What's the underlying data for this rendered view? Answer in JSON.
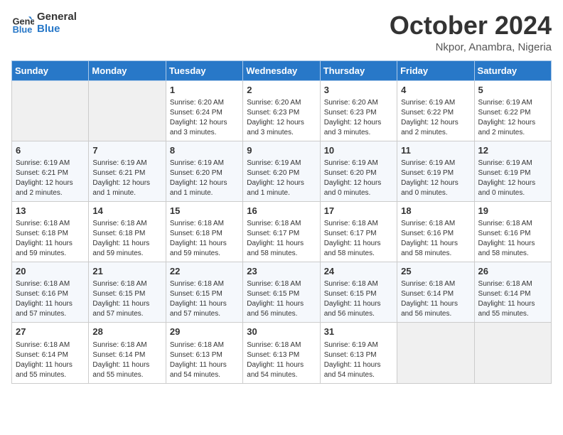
{
  "header": {
    "logo_line1": "General",
    "logo_line2": "Blue",
    "month": "October 2024",
    "location": "Nkpor, Anambra, Nigeria"
  },
  "weekdays": [
    "Sunday",
    "Monday",
    "Tuesday",
    "Wednesday",
    "Thursday",
    "Friday",
    "Saturday"
  ],
  "weeks": [
    [
      {
        "day": "",
        "info": ""
      },
      {
        "day": "",
        "info": ""
      },
      {
        "day": "1",
        "info": "Sunrise: 6:20 AM\nSunset: 6:24 PM\nDaylight: 12 hours and 3 minutes."
      },
      {
        "day": "2",
        "info": "Sunrise: 6:20 AM\nSunset: 6:23 PM\nDaylight: 12 hours and 3 minutes."
      },
      {
        "day": "3",
        "info": "Sunrise: 6:20 AM\nSunset: 6:23 PM\nDaylight: 12 hours and 3 minutes."
      },
      {
        "day": "4",
        "info": "Sunrise: 6:19 AM\nSunset: 6:22 PM\nDaylight: 12 hours and 2 minutes."
      },
      {
        "day": "5",
        "info": "Sunrise: 6:19 AM\nSunset: 6:22 PM\nDaylight: 12 hours and 2 minutes."
      }
    ],
    [
      {
        "day": "6",
        "info": "Sunrise: 6:19 AM\nSunset: 6:21 PM\nDaylight: 12 hours and 2 minutes."
      },
      {
        "day": "7",
        "info": "Sunrise: 6:19 AM\nSunset: 6:21 PM\nDaylight: 12 hours and 1 minute."
      },
      {
        "day": "8",
        "info": "Sunrise: 6:19 AM\nSunset: 6:20 PM\nDaylight: 12 hours and 1 minute."
      },
      {
        "day": "9",
        "info": "Sunrise: 6:19 AM\nSunset: 6:20 PM\nDaylight: 12 hours and 1 minute."
      },
      {
        "day": "10",
        "info": "Sunrise: 6:19 AM\nSunset: 6:20 PM\nDaylight: 12 hours and 0 minutes."
      },
      {
        "day": "11",
        "info": "Sunrise: 6:19 AM\nSunset: 6:19 PM\nDaylight: 12 hours and 0 minutes."
      },
      {
        "day": "12",
        "info": "Sunrise: 6:19 AM\nSunset: 6:19 PM\nDaylight: 12 hours and 0 minutes."
      }
    ],
    [
      {
        "day": "13",
        "info": "Sunrise: 6:18 AM\nSunset: 6:18 PM\nDaylight: 11 hours and 59 minutes."
      },
      {
        "day": "14",
        "info": "Sunrise: 6:18 AM\nSunset: 6:18 PM\nDaylight: 11 hours and 59 minutes."
      },
      {
        "day": "15",
        "info": "Sunrise: 6:18 AM\nSunset: 6:18 PM\nDaylight: 11 hours and 59 minutes."
      },
      {
        "day": "16",
        "info": "Sunrise: 6:18 AM\nSunset: 6:17 PM\nDaylight: 11 hours and 58 minutes."
      },
      {
        "day": "17",
        "info": "Sunrise: 6:18 AM\nSunset: 6:17 PM\nDaylight: 11 hours and 58 minutes."
      },
      {
        "day": "18",
        "info": "Sunrise: 6:18 AM\nSunset: 6:16 PM\nDaylight: 11 hours and 58 minutes."
      },
      {
        "day": "19",
        "info": "Sunrise: 6:18 AM\nSunset: 6:16 PM\nDaylight: 11 hours and 58 minutes."
      }
    ],
    [
      {
        "day": "20",
        "info": "Sunrise: 6:18 AM\nSunset: 6:16 PM\nDaylight: 11 hours and 57 minutes."
      },
      {
        "day": "21",
        "info": "Sunrise: 6:18 AM\nSunset: 6:15 PM\nDaylight: 11 hours and 57 minutes."
      },
      {
        "day": "22",
        "info": "Sunrise: 6:18 AM\nSunset: 6:15 PM\nDaylight: 11 hours and 57 minutes."
      },
      {
        "day": "23",
        "info": "Sunrise: 6:18 AM\nSunset: 6:15 PM\nDaylight: 11 hours and 56 minutes."
      },
      {
        "day": "24",
        "info": "Sunrise: 6:18 AM\nSunset: 6:15 PM\nDaylight: 11 hours and 56 minutes."
      },
      {
        "day": "25",
        "info": "Sunrise: 6:18 AM\nSunset: 6:14 PM\nDaylight: 11 hours and 56 minutes."
      },
      {
        "day": "26",
        "info": "Sunrise: 6:18 AM\nSunset: 6:14 PM\nDaylight: 11 hours and 55 minutes."
      }
    ],
    [
      {
        "day": "27",
        "info": "Sunrise: 6:18 AM\nSunset: 6:14 PM\nDaylight: 11 hours and 55 minutes."
      },
      {
        "day": "28",
        "info": "Sunrise: 6:18 AM\nSunset: 6:14 PM\nDaylight: 11 hours and 55 minutes."
      },
      {
        "day": "29",
        "info": "Sunrise: 6:18 AM\nSunset: 6:13 PM\nDaylight: 11 hours and 54 minutes."
      },
      {
        "day": "30",
        "info": "Sunrise: 6:18 AM\nSunset: 6:13 PM\nDaylight: 11 hours and 54 minutes."
      },
      {
        "day": "31",
        "info": "Sunrise: 6:19 AM\nSunset: 6:13 PM\nDaylight: 11 hours and 54 minutes."
      },
      {
        "day": "",
        "info": ""
      },
      {
        "day": "",
        "info": ""
      }
    ]
  ]
}
